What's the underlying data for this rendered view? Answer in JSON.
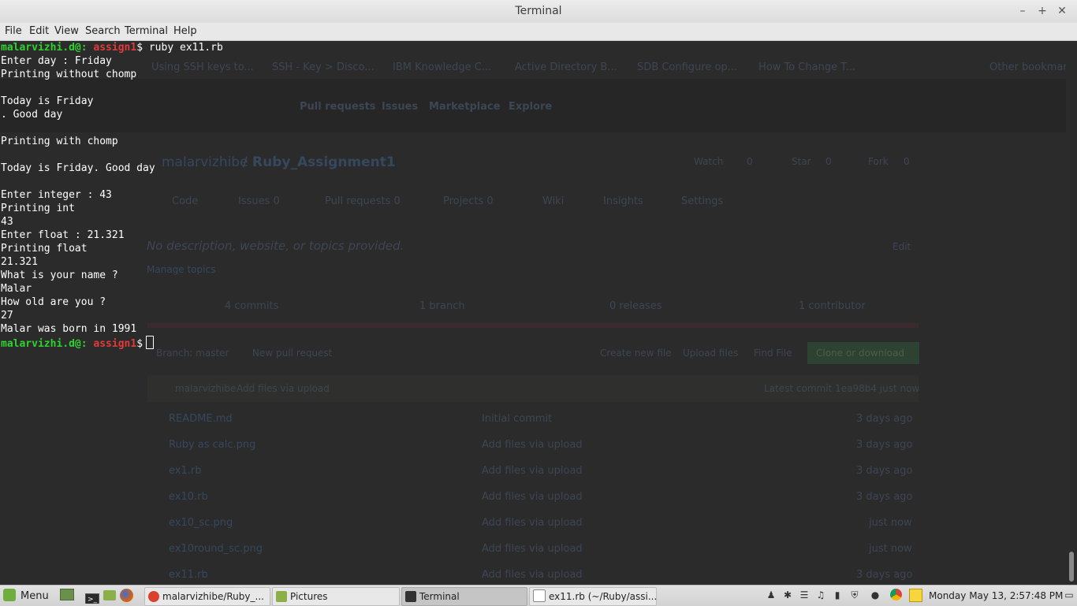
{
  "window": {
    "title": "Terminal",
    "minimize": "–",
    "maximize": "+",
    "close": "✕"
  },
  "menu": [
    "File",
    "Edit",
    "View",
    "Search",
    "Terminal",
    "Help"
  ],
  "prompt": {
    "user": "malarvizhi.d@:",
    "dir": "assign1",
    "symbol": "$"
  },
  "terminal_lines": [
    {
      "type": "prompt",
      "cmd": " ruby ex11.rb"
    },
    {
      "type": "out",
      "text": "Enter day : Friday"
    },
    {
      "type": "out",
      "text": "Printing without chomp"
    },
    {
      "type": "out",
      "text": ""
    },
    {
      "type": "out",
      "text": "Today is Friday"
    },
    {
      "type": "out",
      "text": ". Good day"
    },
    {
      "type": "out",
      "text": ""
    },
    {
      "type": "out",
      "text": "Printing with chomp"
    },
    {
      "type": "out",
      "text": ""
    },
    {
      "type": "out",
      "text": "Today is Friday. Good day"
    },
    {
      "type": "out",
      "text": ""
    },
    {
      "type": "out",
      "text": "Enter integer : 43"
    },
    {
      "type": "out",
      "text": "Printing int"
    },
    {
      "type": "out",
      "text": "43"
    },
    {
      "type": "out",
      "text": "Enter float : 21.321"
    },
    {
      "type": "out",
      "text": "Printing float"
    },
    {
      "type": "out",
      "text": "21.321"
    },
    {
      "type": "out",
      "text": "What is your name ?"
    },
    {
      "type": "out",
      "text": "Malar"
    },
    {
      "type": "out",
      "text": "How old are you ?"
    },
    {
      "type": "out",
      "text": "27"
    },
    {
      "type": "out",
      "text": "Malar was born in 1991"
    },
    {
      "type": "prompt",
      "cmd": " ",
      "cursor": true
    }
  ],
  "background_ghost": {
    "bookmarks": [
      "Using SSH keys to...",
      "SSH - Key > Disco...",
      "IBM Knowledge C...",
      "Active Directory B...",
      "SDB Configure op...",
      "How To Change T...",
      "Other bookmarks"
    ],
    "nav": [
      "Pull requests",
      "Issues",
      "Marketplace",
      "Explore"
    ],
    "repo_owner": "malarvizhibe",
    "repo_sep": "/",
    "repo_name": "Ruby_Assignment1",
    "watch": "Watch",
    "watch_count": "0",
    "star": "Star",
    "star_count": "0",
    "fork": "Fork",
    "fork_count": "0",
    "tabs": [
      "Code",
      "Issues 0",
      "Pull requests 0",
      "Projects 0",
      "Wiki",
      "Insights",
      "Settings"
    ],
    "description": "No description, website, or topics provided.",
    "edit": "Edit",
    "manage_topics": "Manage topics",
    "stats": [
      "4 commits",
      "1 branch",
      "0 releases",
      "1 contributor"
    ],
    "branch": "Branch: master",
    "new_pr": "New pull request",
    "actions": [
      "Create new file",
      "Upload files",
      "Find File",
      "Clone or download"
    ],
    "commit_user": "malarvizhibe",
    "commit_msg": "Add files via upload",
    "latest_commit": "Latest commit 1ea98b4 just now",
    "files": [
      {
        "name": "README.md",
        "msg": "Initial commit",
        "age": "3 days ago"
      },
      {
        "name": "Ruby as calc.png",
        "msg": "Add files via upload",
        "age": "3 days ago"
      },
      {
        "name": "ex1.rb",
        "msg": "Add files via upload",
        "age": "3 days ago"
      },
      {
        "name": "ex10.rb",
        "msg": "Add files via upload",
        "age": "3 days ago"
      },
      {
        "name": "ex10_sc.png",
        "msg": "Add files via upload",
        "age": "just now"
      },
      {
        "name": "ex10round_sc.png",
        "msg": "Add files via upload",
        "age": "just now"
      },
      {
        "name": "ex11.rb",
        "msg": "Add files via upload",
        "age": "3 days ago"
      }
    ]
  },
  "taskbar": {
    "menu_label": "Menu",
    "windows": [
      {
        "label": "malarvizhibe/Ruby_...",
        "icon_color": "#d9412c",
        "active": false
      },
      {
        "label": "Pictures",
        "icon_color": "#8bb04a",
        "active": false
      },
      {
        "label": "Terminal",
        "icon_color": "#333333",
        "active": true
      },
      {
        "label": "ex11.rb (~/Ruby/assi...",
        "icon_color": "#ffffff",
        "active": false
      }
    ],
    "clock": "Monday May 13,  2:57:48 PM"
  },
  "colors": {
    "prompt_user": "#2fd12f",
    "prompt_dir": "#e23a3a",
    "terminal_bg": "#2b2b2b",
    "terminal_fg": "#ffffff"
  }
}
